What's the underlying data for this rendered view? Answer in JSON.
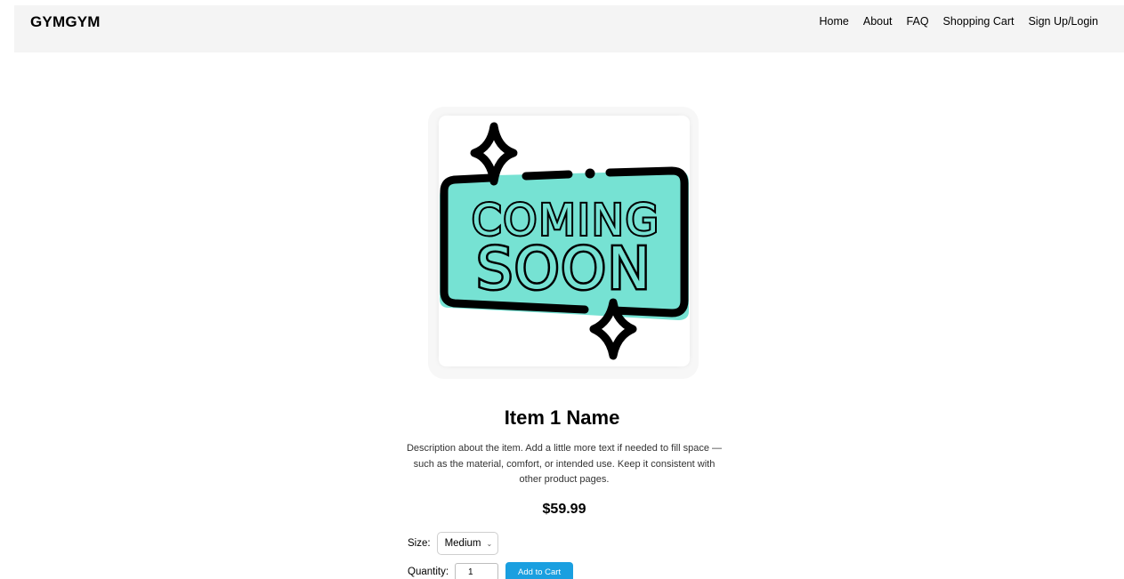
{
  "header": {
    "brand": "GYMGYM",
    "nav": [
      {
        "label": "Home"
      },
      {
        "label": "About"
      },
      {
        "label": "FAQ"
      },
      {
        "label": "Shopping Cart"
      },
      {
        "label": "Sign Up/Login"
      }
    ]
  },
  "product": {
    "image": {
      "badge_line1": "COMING",
      "badge_line2": "SOON",
      "badge_fill": "#76e2d3",
      "outline_color": "#000000"
    },
    "name": "Item 1 Name",
    "description": "Description about the item. Add a little more text if needed to fill space — such as the material, comfort, or intended use. Keep it consistent with other product pages.",
    "price": "$59.99"
  },
  "form": {
    "size_label": "Size:",
    "size_selected": "Medium",
    "quantity_label": "Quantity:",
    "quantity_value": "1",
    "add_to_cart_label": "Add to Cart",
    "button_color": "#1a9fe0"
  }
}
